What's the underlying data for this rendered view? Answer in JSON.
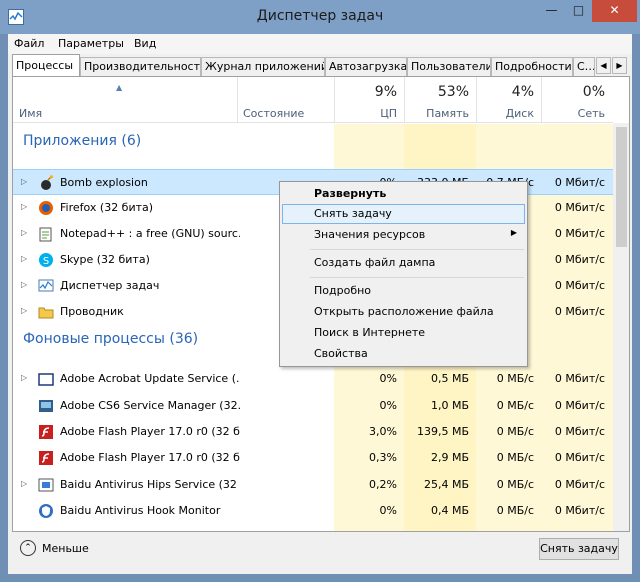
{
  "window": {
    "title": "Диспетчер задач"
  },
  "menu": [
    "Файл",
    "Параметры",
    "Вид"
  ],
  "tabs": [
    "Процессы",
    "Производительность",
    "Журнал приложений",
    "Автозагрузка",
    "Пользователи",
    "Подробности",
    "С…"
  ],
  "header": {
    "name": "Имя",
    "status": "Состояние",
    "cpu_pct": "9%",
    "cpu_label": "ЦП",
    "mem_pct": "53%",
    "mem_label": "Память",
    "disk_pct": "4%",
    "disk_label": "Диск",
    "net_pct": "0%",
    "net_label": "Сеть"
  },
  "groups": {
    "apps": "Приложения (6)",
    "background": "Фоновые процессы (36)"
  },
  "apps": [
    {
      "name": "Bomb explosion",
      "icon": "bomb-icon",
      "cpu": "0%",
      "mem": "333,0 МБ",
      "disk": "0,7 МБ/с",
      "net": "0 Мбит/с"
    },
    {
      "name": "Firefox (32 бита)",
      "icon": "firefox-icon",
      "cpu": "",
      "mem": "",
      "disk": "",
      "net": "0 Мбит/с"
    },
    {
      "name": "Notepad++ : a free (GNU) sourc...",
      "icon": "notepad-icon",
      "cpu": "",
      "mem": "",
      "disk": "",
      "net": "0 Мбит/с"
    },
    {
      "name": "Skype (32 бита)",
      "icon": "skype-icon",
      "cpu": "",
      "mem": "",
      "disk": "",
      "net": "0 Мбит/с"
    },
    {
      "name": "Диспетчер задач",
      "icon": "task-manager-icon",
      "cpu": "",
      "mem": "",
      "disk": "",
      "net": "0 Мбит/с"
    },
    {
      "name": "Проводник",
      "icon": "folder-icon",
      "cpu": "",
      "mem": "",
      "disk": "",
      "net": "0 Мбит/с"
    }
  ],
  "background": [
    {
      "name": "Adobe Acrobat Update Service (...",
      "icon": "window-icon",
      "cpu": "0%",
      "mem": "0,5 МБ",
      "disk": "0 МБ/с",
      "net": "0 Мбит/с"
    },
    {
      "name": "Adobe CS6 Service Manager (32...",
      "icon": "service-icon",
      "cpu": "0%",
      "mem": "1,0 МБ",
      "disk": "0 МБ/с",
      "net": "0 Мбит/с"
    },
    {
      "name": "Adobe Flash Player 17.0 r0 (32 б...",
      "icon": "flash-icon",
      "cpu": "3,0%",
      "mem": "139,5 МБ",
      "disk": "0 МБ/с",
      "net": "0 Мбит/с"
    },
    {
      "name": "Adobe Flash Player 17.0 r0 (32 б...",
      "icon": "flash-icon",
      "cpu": "0,3%",
      "mem": "2,9 МБ",
      "disk": "0 МБ/с",
      "net": "0 Мбит/с"
    },
    {
      "name": "Baidu Antivirus Hips Service (32 ...",
      "icon": "baidu-icon",
      "cpu": "0,2%",
      "mem": "25,4 МБ",
      "disk": "0 МБ/с",
      "net": "0 Мбит/с"
    },
    {
      "name": "Baidu Antivirus Hook Monitor",
      "icon": "shield-icon",
      "cpu": "0%",
      "mem": "0,4 МБ",
      "disk": "0 МБ/с",
      "net": "0 Мбит/с"
    }
  ],
  "context_menu": {
    "expand": "Развернуть",
    "end_task": "Снять задачу",
    "resource_values": "Значения ресурсов",
    "create_dump": "Создать файл дампа",
    "details": "Подробно",
    "open_location": "Открыть расположение файла",
    "search_online": "Поиск в Интернете",
    "properties": "Свойства"
  },
  "footer": {
    "less": "Меньше",
    "end_task": "Снять задачу"
  },
  "colors": {
    "group": "#2965b8",
    "heat_light": "#fff4c4",
    "heat_mid": "#ffe9a8",
    "selected": "#cce8ff"
  }
}
